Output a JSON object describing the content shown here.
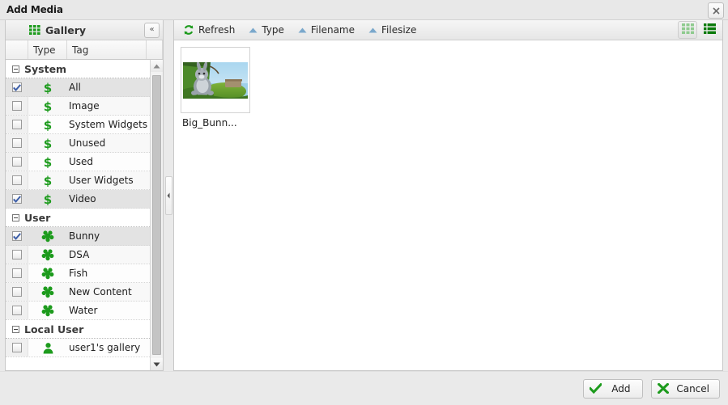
{
  "window": {
    "title": "Add Media",
    "close_icon": "close-icon"
  },
  "sidebar": {
    "header": {
      "label": "Gallery",
      "icon": "gallery-grid-icon",
      "collapse_label": "«"
    },
    "columns": [
      "",
      "Type",
      "Tag",
      ""
    ],
    "groups": [
      {
        "title": "System",
        "icon": "tag-dollar-icon",
        "items": [
          {
            "label": "All",
            "checked": true
          },
          {
            "label": "Image",
            "checked": false
          },
          {
            "label": "System Widgets",
            "checked": false
          },
          {
            "label": "Unused",
            "checked": false
          },
          {
            "label": "Used",
            "checked": false
          },
          {
            "label": "User Widgets",
            "checked": false
          },
          {
            "label": "Video",
            "checked": true
          }
        ]
      },
      {
        "title": "User",
        "icon": "puzzle-icon",
        "items": [
          {
            "label": "Bunny",
            "checked": true
          },
          {
            "label": "DSA",
            "checked": false
          },
          {
            "label": "Fish",
            "checked": false
          },
          {
            "label": "New Content",
            "checked": false
          },
          {
            "label": "Water",
            "checked": false
          }
        ]
      },
      {
        "title": "Local User",
        "icon": "user-icon",
        "items": [
          {
            "label": "user1's gallery",
            "checked": false
          }
        ]
      }
    ]
  },
  "toolbar": {
    "refresh_label": "Refresh",
    "refresh_icon": "refresh-icon",
    "sort_items": [
      {
        "label": "Type",
        "icon": "sort-asc-icon"
      },
      {
        "label": "Filename",
        "icon": "sort-asc-icon"
      },
      {
        "label": "Filesize",
        "icon": "sort-asc-icon"
      }
    ],
    "views": [
      {
        "name": "grid-view",
        "icon": "grid-view-icon",
        "active": true
      },
      {
        "name": "list-view",
        "icon": "list-view-icon",
        "active": false
      }
    ]
  },
  "content": {
    "items": [
      {
        "caption": "Big_Bunn...",
        "type": "video-thumbnail"
      }
    ]
  },
  "footer": {
    "add_label": "Add",
    "add_icon": "check-icon",
    "cancel_label": "Cancel",
    "cancel_icon": "cross-icon"
  },
  "colors": {
    "accent_green": "#1d9b1d",
    "icon_green": "#2a9b2a",
    "sort_blue": "#7aa8cc",
    "check_blue": "#3c5ea8",
    "window_bg": "#eaeaea"
  }
}
